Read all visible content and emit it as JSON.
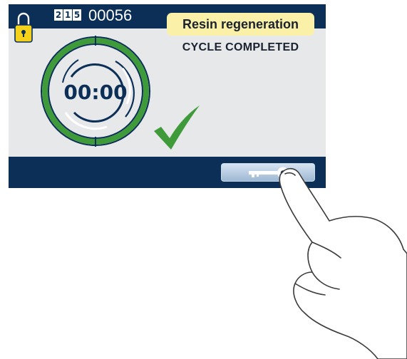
{
  "header": {
    "cycle_digits": [
      "2",
      "1",
      "5"
    ],
    "counter": "00056",
    "lock_icon": "padlock-icon"
  },
  "program": {
    "name": "Resin regeneration",
    "status": "CYCLE COMPLETED"
  },
  "timer": {
    "remaining": "00:00",
    "progress_fraction": 1.0
  },
  "footer": {
    "key_button_icon": "key-icon"
  },
  "colors": {
    "screen_bg": "#e7e8ea",
    "bar_navy": "#0b2f57",
    "progress_green": "#3f9a3a",
    "check_green": "#3f9a3a",
    "label_yellow": "#fbf0a7"
  }
}
